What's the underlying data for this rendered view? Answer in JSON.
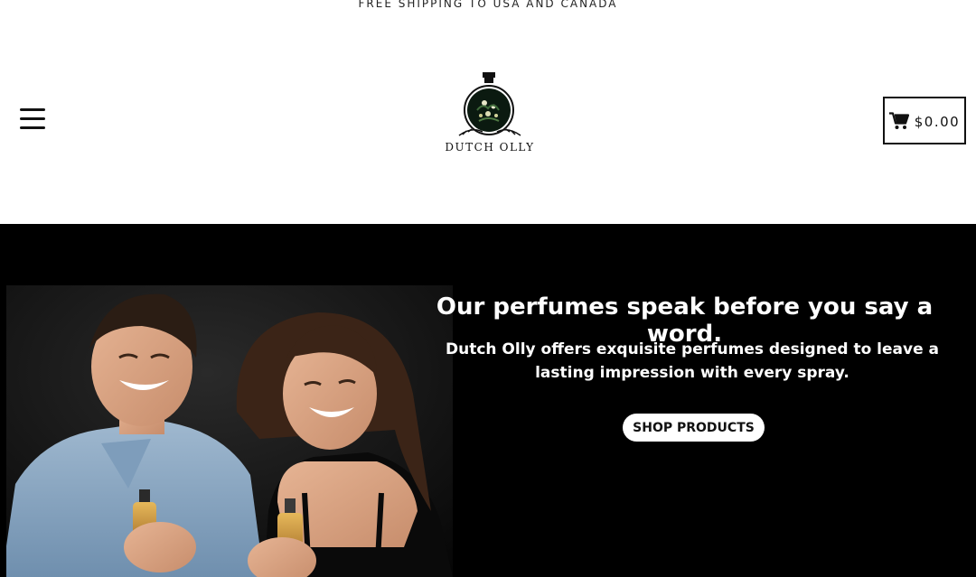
{
  "announcement": {
    "text": "FREE SHIPPING TO USA AND CANADA"
  },
  "header": {
    "menu_icon": "hamburger-icon",
    "logo": {
      "text": "DUTCH OLLY",
      "icon": "perfume-bottle-logo"
    },
    "cart": {
      "icon": "cart-icon",
      "amount": "$0.00"
    }
  },
  "hero": {
    "title": "Our perfumes speak before you say a word.",
    "subtitle": "Dutch Olly offers exquisite perfumes designed to leave a lasting impression with every spray.",
    "cta_label": "SHOP PRODUCTS",
    "image": "couple-laughing-with-perfume"
  },
  "colors": {
    "background": "#ffffff",
    "hero_background": "#000000",
    "text": "#111111",
    "button_bg": "#ffffff"
  }
}
